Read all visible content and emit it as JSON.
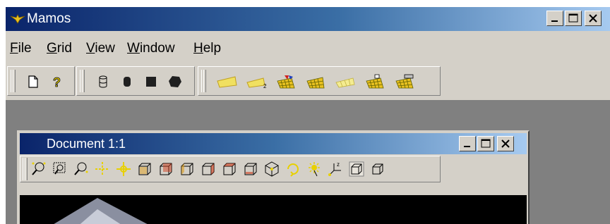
{
  "app": {
    "title": "Mamos",
    "icon": "mamos-app-icon",
    "caption_buttons": [
      "minimize",
      "maximize",
      "close"
    ]
  },
  "menu": [
    {
      "accel": "F",
      "rest": "ile"
    },
    {
      "accel": "G",
      "rest": "rid"
    },
    {
      "accel": "V",
      "rest": "iew"
    },
    {
      "accel": "W",
      "rest": "indow"
    },
    {
      "accel": "H",
      "rest": "elp"
    }
  ],
  "toolbars": {
    "standard": [
      "new-document-icon",
      "help-icon"
    ],
    "shapes": [
      "cylinder-outline-icon",
      "cylinder-solid-icon",
      "square-solid-icon",
      "polygon-solid-icon"
    ],
    "grid": [
      "surface-icon",
      "surface-2-icon",
      "grid-colored-icon",
      "grid-mesh-icon",
      "grid-flat-icon",
      "grid-edit-icon",
      "grid-print-icon"
    ]
  },
  "highlight_color": "#e00000",
  "document": {
    "title": "Document 1:1",
    "caption_buttons": [
      "minimize",
      "maximize",
      "close"
    ],
    "toolbar": [
      "zoom-in-icon",
      "zoom-window-icon",
      "zoom-out-icon",
      "pan-icon",
      "center-icon",
      "view-front-icon",
      "view-back-icon",
      "view-left-icon",
      "view-right-icon",
      "view-top-icon",
      "view-bottom-icon",
      "view-iso-icon",
      "rotate-icon",
      "light-icon",
      "axes-icon",
      "wireframe-icon",
      "box-icon"
    ]
  },
  "colors": {
    "titlebar_start": "#0a246a",
    "titlebar_end": "#a6caf0",
    "face": "#d4d0c8",
    "workspace": "#808080"
  }
}
